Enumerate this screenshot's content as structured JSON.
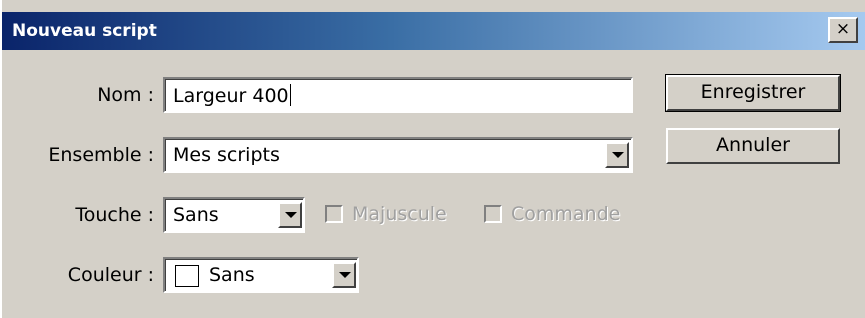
{
  "window": {
    "title": "Nouveau script",
    "close_glyph": "×"
  },
  "form": {
    "nom_label": "Nom :",
    "nom_value": "Largeur 400",
    "ensemble_label": "Ensemble :",
    "ensemble_value": "Mes scripts",
    "touche_label": "Touche :",
    "touche_value": "Sans",
    "majuscule_label": "Majuscule",
    "majuscule_checked": false,
    "commande_label": "Commande",
    "commande_checked": false,
    "couleur_label": "Couleur :",
    "couleur_value": "Sans",
    "couleur_swatch": "#ffffff"
  },
  "buttons": {
    "save_label": "Enregistrer",
    "cancel_label": "Annuler"
  },
  "colors": {
    "title_gradient_start": "#0a246a",
    "title_gradient_end": "#a6caf0",
    "dialog_bg": "#d4d0c8"
  }
}
